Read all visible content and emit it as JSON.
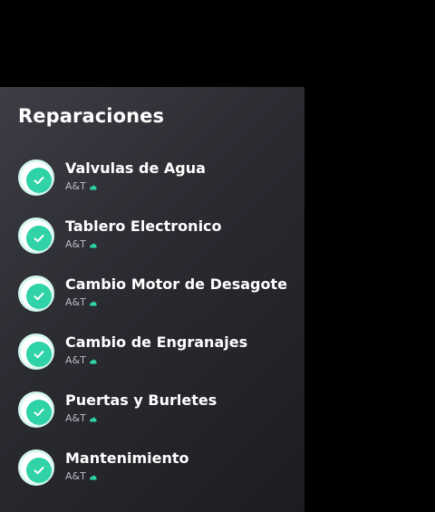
{
  "title": "Reparaciones",
  "colors": {
    "accent": "#2fd3a7",
    "panel": "#2a2a31"
  },
  "items": [
    {
      "label": "Valvulas de Agua",
      "meta": "A&T",
      "icon": "check-icon"
    },
    {
      "label": "Tablero Electronico",
      "meta": "A&T",
      "icon": "check-icon"
    },
    {
      "label": "Cambio Motor de Desagote",
      "meta": "A&T",
      "icon": "check-icon"
    },
    {
      "label": "Cambio de Engranajes",
      "meta": "A&T",
      "icon": "check-icon"
    },
    {
      "label": "Puertas y Burletes",
      "meta": "A&T",
      "icon": "check-icon"
    },
    {
      "label": "Mantenimiento",
      "meta": "A&T",
      "icon": "check-icon"
    }
  ]
}
